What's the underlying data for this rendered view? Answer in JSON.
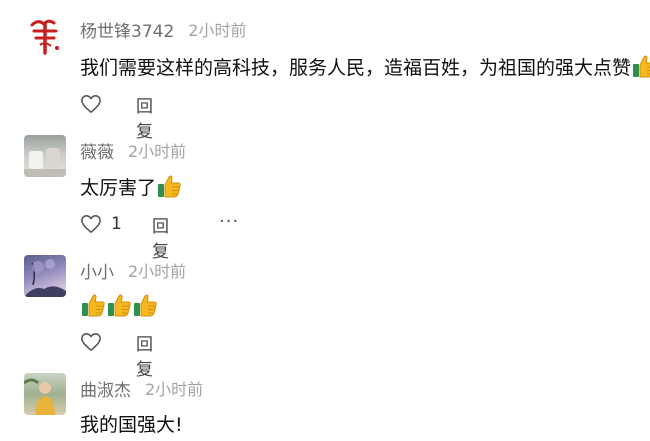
{
  "comments": [
    {
      "username": "杨世锋3742",
      "time": "2小时前",
      "text": "我们需要这样的高科技，服务人民，造福百姓，为祖国的强大点赞",
      "reply_label": "回复",
      "thumbs": 1
    },
    {
      "username": "薇薇",
      "time": "2小时前",
      "text": "太厉害了",
      "reply_label": "回复",
      "like_count": "1",
      "more_label": "···",
      "thumbs": 1
    },
    {
      "username": "小小",
      "time": "2小时前",
      "text": "",
      "reply_label": "回复",
      "thumbs": 3
    },
    {
      "username": "曲淑杰",
      "time": "2小时前",
      "text": "我的国强大!",
      "thumbs": 0
    }
  ],
  "colors": {
    "username": "#6f6f6f",
    "time": "#a3a3a3",
    "text": "#111111",
    "icon": "#555555",
    "thumb_yellow": "#f5b81f",
    "thumb_green": "#2f8f4e"
  },
  "icons": {
    "like": "heart-outline-icon",
    "reaction": "thumbs-up-emoji-icon"
  }
}
